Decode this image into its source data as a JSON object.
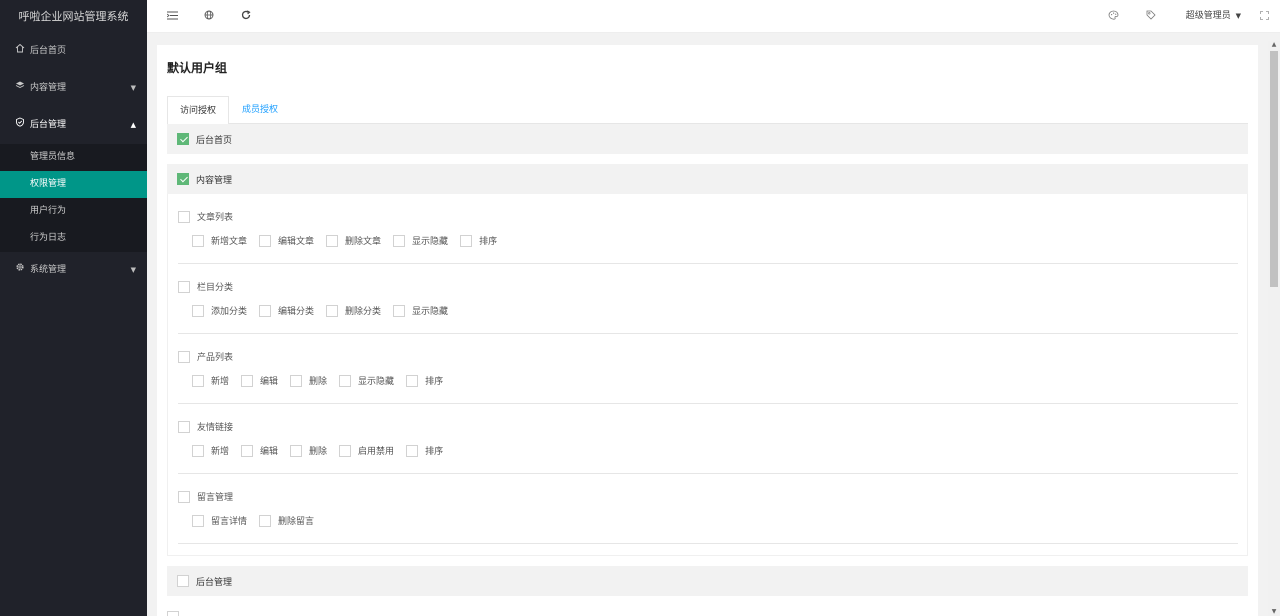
{
  "app": {
    "title": "呼啦企业网站管理系统"
  },
  "sidebar": {
    "items": [
      {
        "label": "后台首页",
        "icon": "home-icon"
      },
      {
        "label": "内容管理",
        "icon": "layers-icon"
      },
      {
        "label": "后台管理",
        "icon": "shield-icon"
      },
      {
        "label": "系统管理",
        "icon": "gear-icon"
      }
    ],
    "submenu": [
      {
        "label": "管理员信息"
      },
      {
        "label": "权限管理"
      },
      {
        "label": "用户行为"
      },
      {
        "label": "行为日志"
      }
    ]
  },
  "header": {
    "user": "超级管理员"
  },
  "page": {
    "title": "默认用户组",
    "tabs": [
      {
        "label": "访问授权"
      },
      {
        "label": "成员授权"
      }
    ]
  },
  "groups": {
    "home": "后台首页",
    "content": "内容管理",
    "admin": "后台管理"
  },
  "sections": [
    {
      "label": "文章列表",
      "perms": [
        "新增文章",
        "编辑文章",
        "删除文章",
        "显示隐藏",
        "排序"
      ]
    },
    {
      "label": "栏目分类",
      "perms": [
        "添加分类",
        "编辑分类",
        "删除分类",
        "显示隐藏"
      ]
    },
    {
      "label": "产品列表",
      "perms": [
        "新增",
        "编辑",
        "删除",
        "显示隐藏",
        "排序"
      ]
    },
    {
      "label": "友情链接",
      "perms": [
        "新增",
        "编辑",
        "删除",
        "启用禁用",
        "排序"
      ]
    },
    {
      "label": "留言管理",
      "perms": [
        "留言详情",
        "删除留言"
      ]
    }
  ],
  "colors": {
    "accent": "#009688",
    "sidebar": "#20222a",
    "checked": "#5fb878",
    "link": "#1e9fff"
  }
}
